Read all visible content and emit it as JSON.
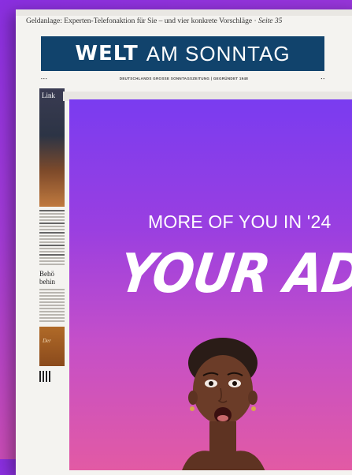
{
  "newspaper": {
    "teaser": "Geldanlage: Experten-Telefonaktion für Sie – und vier konkrete Vorschläge",
    "teaser_page": "Seite 35",
    "brand_part1": "WELT",
    "brand_part2": "AM SONNTAG",
    "tagline": "DEUTSCHLANDS GROSSE SONNTAGSZEITUNG  |  GEGRÜNDET 1948",
    "left_photo_title": "Link",
    "left_headline": "Behö behin"
  },
  "ad": {
    "kicker": "MORE OF YOU IN '24",
    "title": "YOUR AD"
  },
  "colors": {
    "masthead": "#11436c",
    "ad_top": "#7a3cf0",
    "ad_bottom": "#e25aa4"
  }
}
